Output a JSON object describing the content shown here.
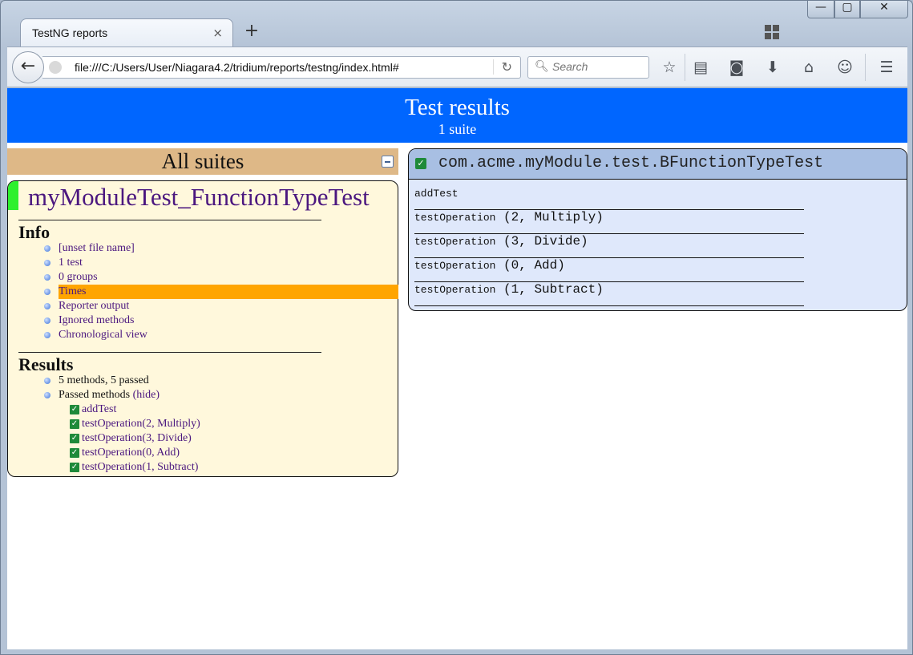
{
  "browser": {
    "tab_title": "TestNG reports",
    "tab_close": "×",
    "new_tab": "+",
    "url": "file:///C:/Users/User/Niagara4.2/tridium/reports/testng/index.html#",
    "search_placeholder": "Search",
    "window_controls": {
      "minimize": "—",
      "maximize": "▢",
      "close": "✕"
    }
  },
  "header": {
    "title": "Test results",
    "subtitle": "1 suite"
  },
  "navigator": {
    "all_suites_label": "All suites",
    "suite_name": "myModuleTest_FunctionTypeTest",
    "info_heading": "Info",
    "info_items": [
      "[unset file name]",
      "1 test",
      "0 groups",
      "Times",
      "Reporter output",
      "Ignored methods",
      "Chronological view"
    ],
    "selected_info_item": "Times",
    "results_heading": "Results",
    "results_summary": "5 methods, 5 passed",
    "passed_methods_label": "Passed methods",
    "hide_link": "(hide)",
    "passed_methods": [
      "addTest",
      "testOperation(2, Multiply)",
      "testOperation(3, Divide)",
      "testOperation(0, Add)",
      "testOperation(1, Subtract)"
    ]
  },
  "class_panel": {
    "class_name": "com.acme.myModule.test.BFunctionTypeTest",
    "methods": [
      {
        "name": "addTest",
        "args": ""
      },
      {
        "name": "testOperation",
        "args": "(2, Multiply)"
      },
      {
        "name": "testOperation",
        "args": "(3, Divide)"
      },
      {
        "name": "testOperation",
        "args": "(0, Add)"
      },
      {
        "name": "testOperation",
        "args": "(1, Subtract)"
      }
    ]
  },
  "colors": {
    "header_bg": "#0066ff",
    "all_suites_bg": "#deb887",
    "suite_bg": "#fff8dc",
    "suite_status_bar": "#2ef02e",
    "selected_item": "#ffa500",
    "link": "#4b177f",
    "class_panel_bg": "#dfe8fb",
    "class_header_bg": "#a8bfe3",
    "pass_check": "#1f8a3a"
  }
}
